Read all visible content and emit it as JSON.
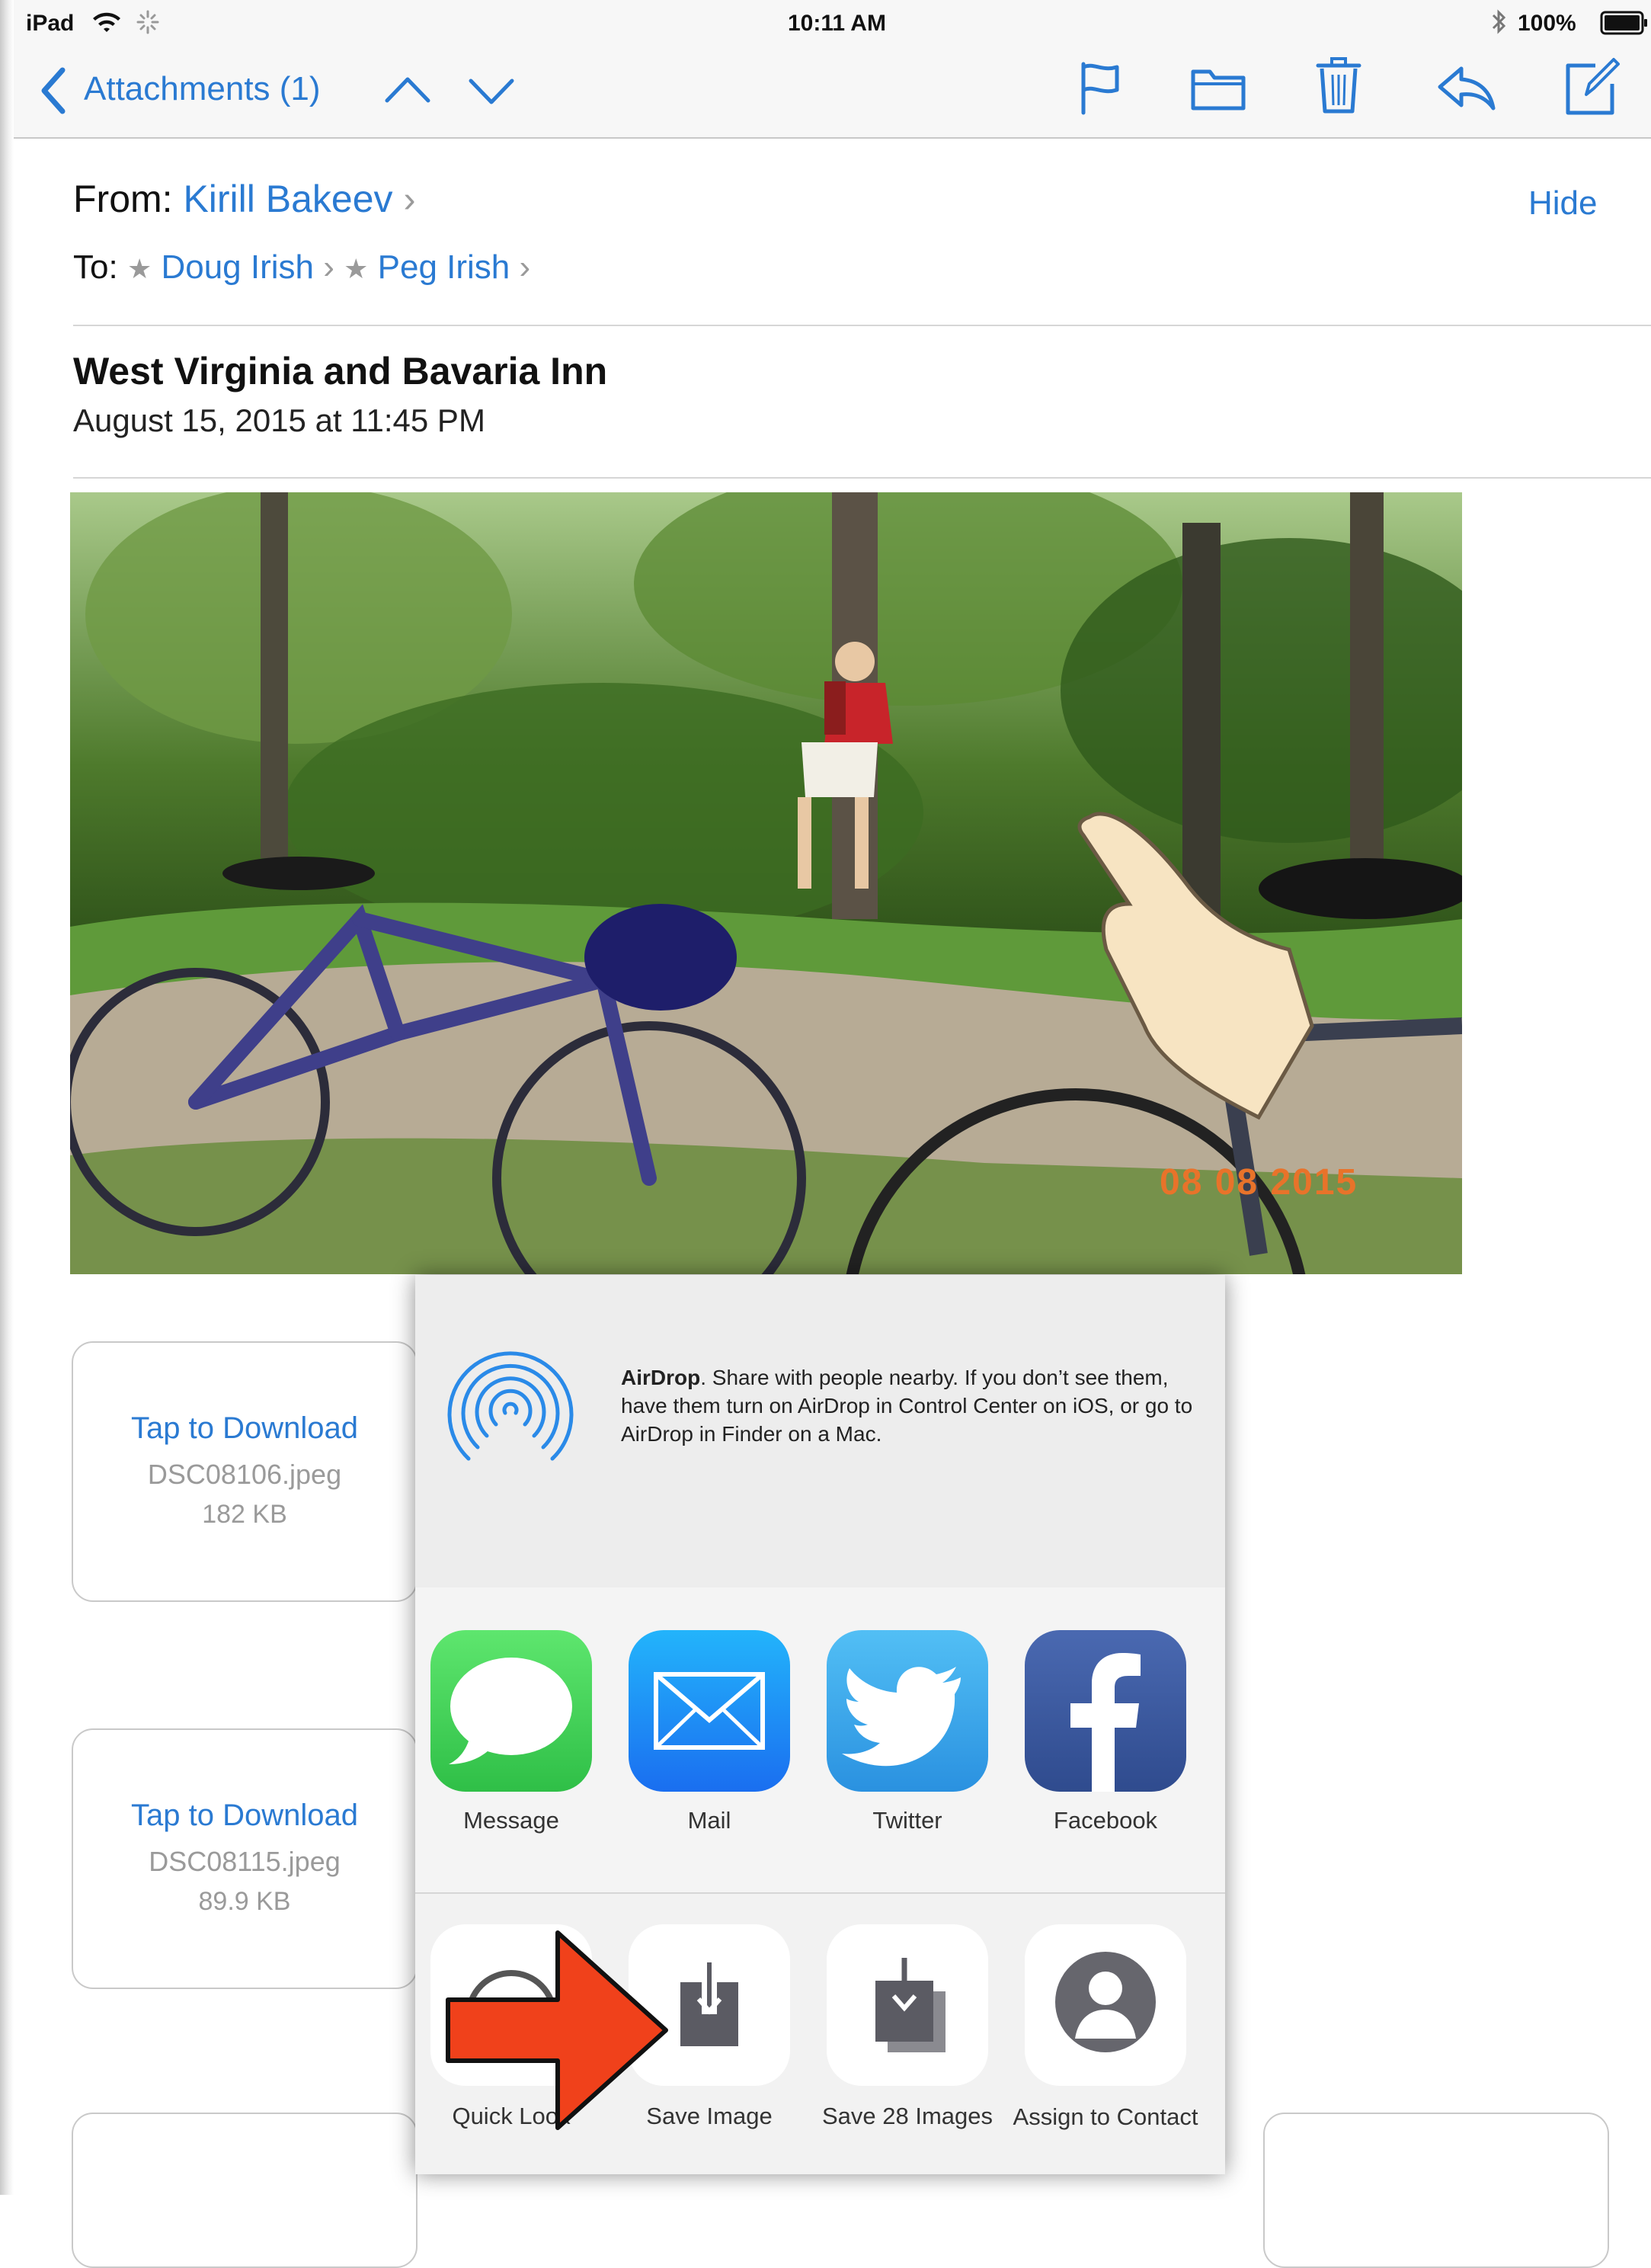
{
  "status_bar": {
    "device": "iPad",
    "time": "10:11 AM",
    "battery": "100%"
  },
  "nav": {
    "back_label": "Attachments (1)",
    "icons": [
      "chevron-up-icon",
      "chevron-down-icon",
      "flag-icon",
      "folder-icon",
      "trash-icon",
      "reply-icon",
      "compose-icon"
    ]
  },
  "header": {
    "from_label": "From:",
    "from_name": "Kirill Bakeev",
    "hide_label": "Hide",
    "to_label": "To:",
    "recipients": [
      "Doug Irish",
      "Peg Irish"
    ]
  },
  "message": {
    "subject": "West Virginia and Bavaria Inn",
    "date": "August 15, 2015 at 11:45 PM"
  },
  "photo": {
    "date_stamp": "08 08 2015"
  },
  "attachments": [
    {
      "action": "Tap to Download",
      "filename": "DSC08106.jpeg",
      "size": "182 KB"
    },
    {
      "action": "Tap to Download",
      "filename": "DSC08115.jpeg",
      "size": "89.9 KB"
    }
  ],
  "share_sheet": {
    "airdrop_title": "AirDrop",
    "airdrop_text": ". Share with people nearby. If you don’t see them, have them turn on AirDrop in Control Center on iOS, or go to AirDrop in Finder on a Mac.",
    "apps": [
      "Message",
      "Mail",
      "Twitter",
      "Facebook"
    ],
    "actions": [
      "Quick Look",
      "Save Image",
      "Save 28 Images",
      "Assign to Contact"
    ]
  },
  "colors": {
    "accent": "#2a7ad2",
    "arrow": "#f0411b",
    "message_green": "#4cd964",
    "mail_blue": "#1e8ef5",
    "twitter_blue": "#34a6ee",
    "facebook_blue": "#3b5998"
  }
}
